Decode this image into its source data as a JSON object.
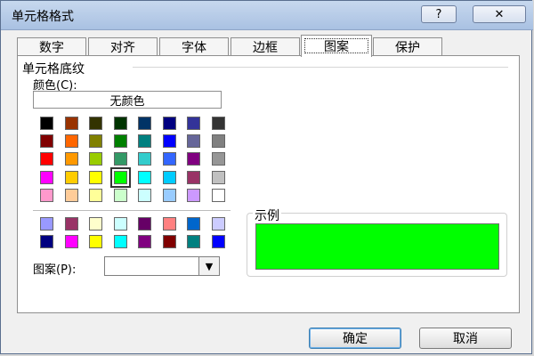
{
  "window": {
    "title": "单元格格式",
    "help": "?",
    "close": "✕"
  },
  "tabs": [
    "数字",
    "对齐",
    "字体",
    "边框",
    "图案",
    "保护"
  ],
  "active_tab": "图案",
  "group": {
    "title": "单元格底纹",
    "color_label": "颜色(C):",
    "no_color": "无颜色",
    "pattern_label": "图案(P):",
    "pattern_value": ""
  },
  "sample": {
    "title": "示例",
    "preview_color": "#00ff00"
  },
  "buttons": {
    "ok": "确定",
    "cancel": "取消"
  },
  "palette": {
    "main": [
      [
        "#000000",
        "#993300",
        "#333300",
        "#003300",
        "#003366",
        "#000080",
        "#333399",
        "#333333"
      ],
      [
        "#800000",
        "#ff6600",
        "#808000",
        "#008000",
        "#008080",
        "#0000ff",
        "#666699",
        "#808080"
      ],
      [
        "#ff0000",
        "#ff9900",
        "#99cc00",
        "#339966",
        "#33cccc",
        "#3366ff",
        "#800080",
        "#969696"
      ],
      [
        "#ff00ff",
        "#ffcc00",
        "#ffff00",
        "#00ff00",
        "#00ffff",
        "#00ccff",
        "#993366",
        "#c0c0c0"
      ],
      [
        "#ff99cc",
        "#ffcc99",
        "#ffff99",
        "#ccffcc",
        "#ccffff",
        "#99ccff",
        "#cc99ff",
        "#ffffff"
      ]
    ],
    "extra": [
      [
        "#9999ff",
        "#993366",
        "#ffffcc",
        "#ccffff",
        "#660066",
        "#ff8080",
        "#0066cc",
        "#ccccff"
      ],
      [
        "#000080",
        "#ff00ff",
        "#ffff00",
        "#00ffff",
        "#800080",
        "#800000",
        "#008080",
        "#0000ff"
      ]
    ],
    "selected": "#00ff00"
  }
}
